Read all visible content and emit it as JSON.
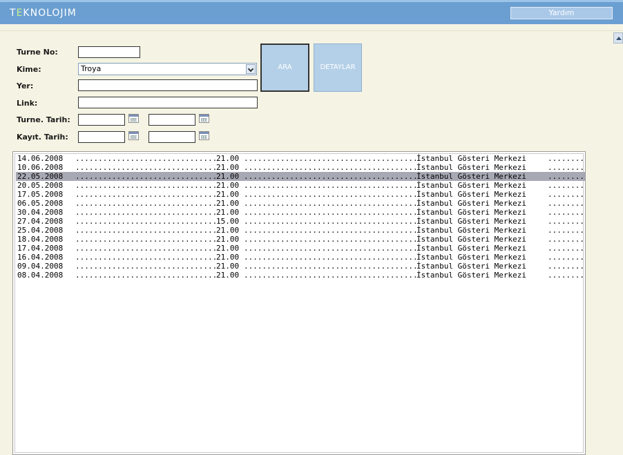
{
  "header": {
    "logo_prefix": "T",
    "logo_accent": "E",
    "logo_rest": "KNOLOJIM",
    "help_label": "Yardım"
  },
  "form": {
    "turne_no_label": "Turne No:",
    "turne_no_value": "",
    "kime_label": "Kime:",
    "kime_value": "Troya",
    "yer_label": "Yer:",
    "yer_value": "",
    "link_label": "Link:",
    "link_value": "",
    "turne_tarih_label": "Turne. Tarih:",
    "turne_tarih_from": "",
    "turne_tarih_to": "",
    "kayit_tarih_label": "Kayıt. Tarih:",
    "kayit_tarih_from": "",
    "kayit_tarih_to": ""
  },
  "buttons": {
    "search_label": "ARA",
    "details_label": "DETAYLAR"
  },
  "list": {
    "selected_index": 2,
    "rows": [
      {
        "date": "14.06.2008",
        "time": "21.00",
        "venue": "İstanbul Gösteri Merkezi"
      },
      {
        "date": "10.06.2008",
        "time": "21.00",
        "venue": "İstanbul Gösteri Merkezi"
      },
      {
        "date": "22.05.2008",
        "time": "21.00",
        "venue": "İstanbul Gösteri Merkezi"
      },
      {
        "date": "20.05.2008",
        "time": "21.00",
        "venue": "İstanbul Gösteri Merkezi"
      },
      {
        "date": "17.05.2008",
        "time": "21.00",
        "venue": "İstanbul Gösteri Merkezi"
      },
      {
        "date": "06.05.2008",
        "time": "21.00",
        "venue": "İstanbul Gösteri Merkezi"
      },
      {
        "date": "30.04.2008",
        "time": "21.00",
        "venue": "İstanbul Gösteri Merkezi"
      },
      {
        "date": "27.04.2008",
        "time": "15.00",
        "venue": "İstanbul Gösteri Merkezi"
      },
      {
        "date": "25.04.2008",
        "time": "21.00",
        "venue": "İstanbul Gösteri Merkezi"
      },
      {
        "date": "18.04.2008",
        "time": "21.00",
        "venue": "İstanbul Gösteri Merkezi"
      },
      {
        "date": "17.04.2008",
        "time": "21.00",
        "venue": "İstanbul Gösteri Merkezi"
      },
      {
        "date": "16.04.2008",
        "time": "21.00",
        "venue": "İstanbul Gösteri Merkezi"
      },
      {
        "date": "09.04.2008",
        "time": "21.00",
        "venue": "İstanbul Gösteri Merkezi"
      },
      {
        "date": "08.04.2008",
        "time": "21.00",
        "venue": "İstanbul Gösteri Merkezi"
      }
    ]
  }
}
